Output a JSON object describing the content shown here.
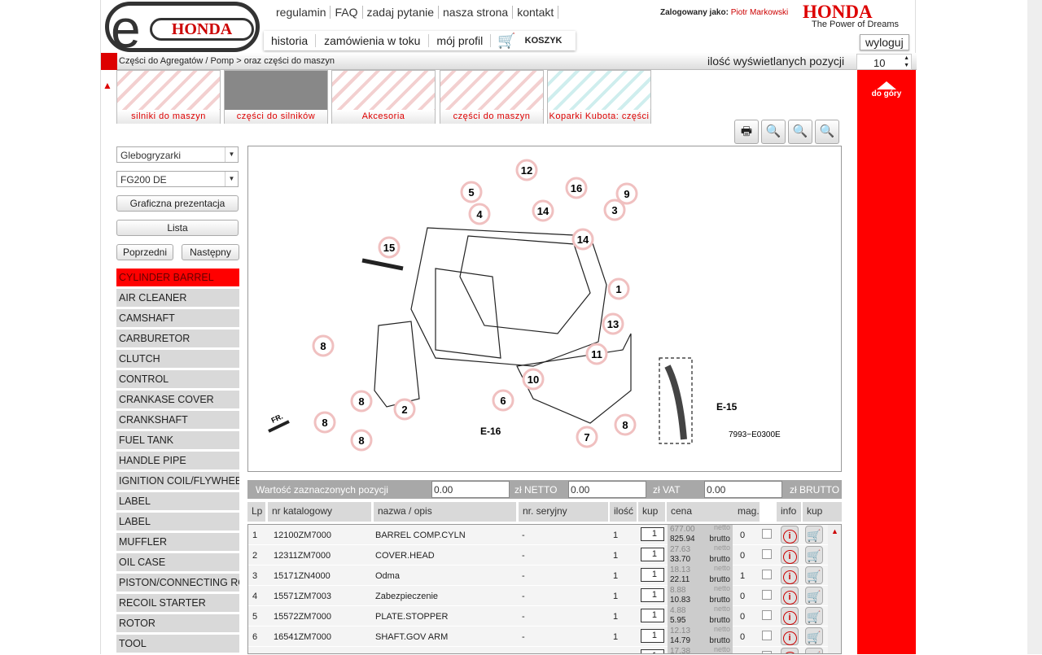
{
  "header": {
    "logo_text": "HONDA",
    "logo_e": "e",
    "links": [
      "regulamin",
      "FAQ",
      "zadaj pytanie",
      "nasza strona",
      "kontakt"
    ],
    "nav": [
      "historia",
      "zamówienia w toku",
      "mój profil"
    ],
    "cart_label": "KOSZYK",
    "logged_label": "Zalogowany jako:",
    "user": "Piotr Markowski",
    "brand": "HONDA",
    "tagline": "The Power of Dreams",
    "logout": "wyloguj"
  },
  "breadcrumb": {
    "text": "Części do Agregatów / Pomp >  oraz części do maszyn",
    "per_page_label": "ilość wyświetlanych pozycji",
    "per_page": "10"
  },
  "to_top": "do góry",
  "categories": [
    "silniki do maszyn",
    "części do silników",
    "Akcesoria",
    "części do maszyn",
    "Koparki Kubota: części"
  ],
  "filters": {
    "type": "Glebogryzarki",
    "model": "FG200 DE",
    "graphic_btn": "Graficzna prezentacja",
    "list_btn": "Lista",
    "prev_btn": "Poprzedni",
    "next_btn": "Następny"
  },
  "menu": [
    "CYLINDER BARREL",
    "AIR CLEANER",
    "CAMSHAFT",
    " CARBURETOR",
    " CLUTCH",
    " CONTROL",
    "CRANKASE COVER",
    "CRANKSHAFT",
    " FUEL TANK",
    "HANDLE PIPE",
    "IGNITION COIL/FLYWHEEL",
    "LABEL",
    " LABEL",
    "MUFFLER",
    "OIL CASE",
    " PISTON/CONNECTING ROD",
    "RECOIL STARTER",
    " ROTOR",
    "TOOL"
  ],
  "menu_active": 0,
  "diagram": {
    "callouts": [
      "1",
      "2",
      "3",
      "4",
      "5",
      "6",
      "7",
      "8",
      "8",
      "8",
      "8",
      "8",
      "9",
      "10",
      "11",
      "12",
      "13",
      "14",
      "14",
      "15",
      "16"
    ],
    "ref_e15": "E-15",
    "ref_e16": "E-16",
    "code": "7993−E0300E",
    "fr": "FR."
  },
  "summary": {
    "label": "Wartość  zaznaczonych pozycji",
    "netto_val": "0.00",
    "netto_label": "zł NETTO",
    "vat_val": "0.00",
    "vat_label": "zł VAT",
    "brutto_val": "0.00",
    "brutto_label": "zł BRUTTO"
  },
  "columns": [
    "Lp",
    "nr katalogowy",
    "nazwa / opis",
    "nr. seryjny",
    "ilość",
    "kup",
    "cena",
    "mag.",
    "info",
    "kup"
  ],
  "price_labels": {
    "netto": "netto",
    "brutto": "brutto"
  },
  "rows": [
    {
      "lp": "1",
      "nr": "12100ZM7000",
      "name": "BARREL COMP.CYLN",
      "serial": "-",
      "qty": "1",
      "buy": "1",
      "netto": "677.00",
      "brutto": "825.94",
      "mag": "0"
    },
    {
      "lp": "2",
      "nr": "12311ZM7000",
      "name": "COVER.HEAD",
      "serial": "-",
      "qty": "1",
      "buy": "1",
      "netto": "27.63",
      "brutto": "33.70",
      "mag": "0"
    },
    {
      "lp": "3",
      "nr": "15171ZN4000",
      "name": "Odma",
      "serial": "-",
      "qty": "1",
      "buy": "1",
      "netto": "18.13",
      "brutto": "22.11",
      "mag": "1"
    },
    {
      "lp": "4",
      "nr": "15571ZM7003",
      "name": "Zabezpieczenie",
      "serial": "-",
      "qty": "1",
      "buy": "1",
      "netto": "8.88",
      "brutto": "10.83",
      "mag": "0"
    },
    {
      "lp": "5",
      "nr": "15572ZM7000",
      "name": "PLATE.STOPPER",
      "serial": "-",
      "qty": "1",
      "buy": "1",
      "netto": "4.88",
      "brutto": "5.95",
      "mag": "0"
    },
    {
      "lp": "6",
      "nr": "16541ZM7000",
      "name": "SHAFT.GOV ARM",
      "serial": "-",
      "qty": "1",
      "buy": "1",
      "netto": "12.13",
      "brutto": "14.79",
      "mag": "0"
    },
    {
      "lp": "7",
      "nr": "",
      "name": "",
      "serial": "",
      "qty": "",
      "buy": "1",
      "netto": "17.38",
      "brutto": "",
      "mag": ""
    }
  ]
}
